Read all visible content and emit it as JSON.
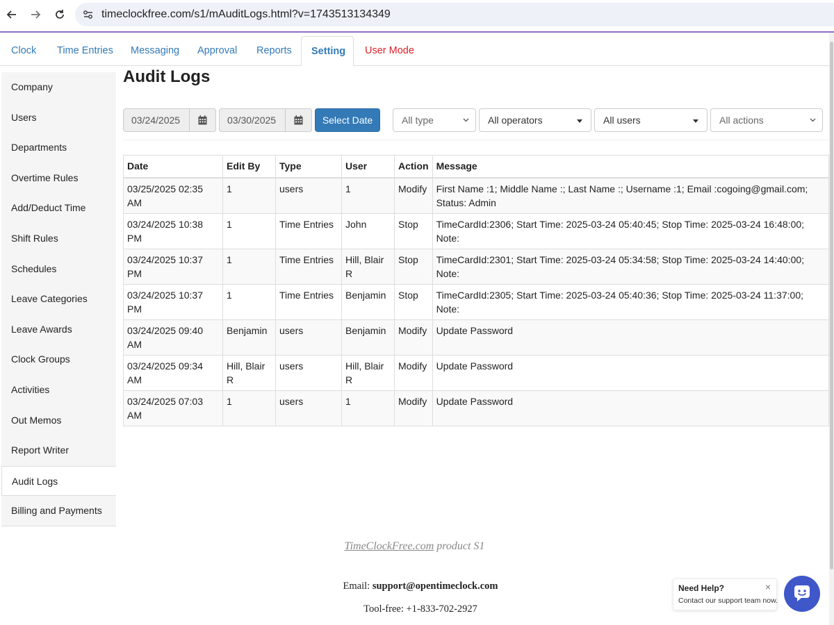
{
  "browser": {
    "url": "timeclockfree.com/s1/mAuditLogs.html?v=1743513134349"
  },
  "tabs": [
    {
      "label": "Clock"
    },
    {
      "label": "Time Entries"
    },
    {
      "label": "Messaging"
    },
    {
      "label": "Approval"
    },
    {
      "label": "Reports"
    },
    {
      "label": "Setting"
    },
    {
      "label": "User Mode"
    }
  ],
  "sidebar": {
    "items": [
      {
        "label": "Company"
      },
      {
        "label": "Users"
      },
      {
        "label": "Departments"
      },
      {
        "label": "Overtime Rules"
      },
      {
        "label": "Add/Deduct Time"
      },
      {
        "label": "Shift Rules"
      },
      {
        "label": "Schedules"
      },
      {
        "label": "Leave Categories"
      },
      {
        "label": "Leave Awards"
      },
      {
        "label": "Clock Groups"
      },
      {
        "label": "Activities"
      },
      {
        "label": "Out Memos"
      },
      {
        "label": "Report Writer"
      },
      {
        "label": "Audit Logs"
      },
      {
        "label": "Billing and Payments"
      }
    ],
    "active": "Audit Logs"
  },
  "page": {
    "title": "Audit Logs"
  },
  "filters": {
    "start_date": "03/24/2025",
    "end_date": "03/30/2025",
    "select_date_label": "Select Date",
    "type": "All type",
    "operators": "All operators",
    "users": "All users",
    "actions": "All actions"
  },
  "table": {
    "headers": [
      "Date",
      "Edit By",
      "Type",
      "User",
      "Action",
      "Message"
    ],
    "rows": [
      [
        "03/25/2025 02:35 AM",
        "1",
        "users",
        "1",
        "Modify",
        "First Name :1; Middle Name :; Last Name :; Username :1; Email :cogoing@gmail.com; Status: Admin"
      ],
      [
        "03/24/2025 10:38 PM",
        "1",
        "Time Entries",
        "John",
        "Stop",
        "TimeCardId:2306; Start Time: 2025-03-24 05:40:45; Stop Time: 2025-03-24 16:48:00; Note:"
      ],
      [
        "03/24/2025 10:37 PM",
        "1",
        "Time Entries",
        "Hill, Blair R",
        "Stop",
        "TimeCardId:2301; Start Time: 2025-03-24 05:34:58; Stop Time: 2025-03-24 14:40:00; Note:"
      ],
      [
        "03/24/2025 10:37 PM",
        "1",
        "Time Entries",
        "Benjamin",
        "Stop",
        "TimeCardId:2305; Start Time: 2025-03-24 05:40:36; Stop Time: 2025-03-24 11:37:00; Note:"
      ],
      [
        "03/24/2025 09:40 AM",
        "Benjamin",
        "users",
        "Benjamin",
        "Modify",
        "Update Password"
      ],
      [
        "03/24/2025 09:34 AM",
        "Hill, Blair R",
        "users",
        "Hill, Blair R",
        "Modify",
        "Update Password"
      ],
      [
        "03/24/2025 07:03 AM",
        "1",
        "users",
        "1",
        "Modify",
        "Update Password"
      ]
    ]
  },
  "footer": {
    "product_link": "TimeClockFree.com",
    "product_suffix": " product S1",
    "email_label": "Email: ",
    "email": "support@opentimeclock.com",
    "phone": "Tool-free: +1-833-702-2927"
  },
  "help_widget": {
    "title": "Need Help?",
    "subtitle": "Contact our support team now.",
    "close": "×"
  },
  "colors": {
    "link_blue": "#337ab7",
    "user_mode_red": "#d9222a",
    "chat_button": "#3f57c9"
  }
}
